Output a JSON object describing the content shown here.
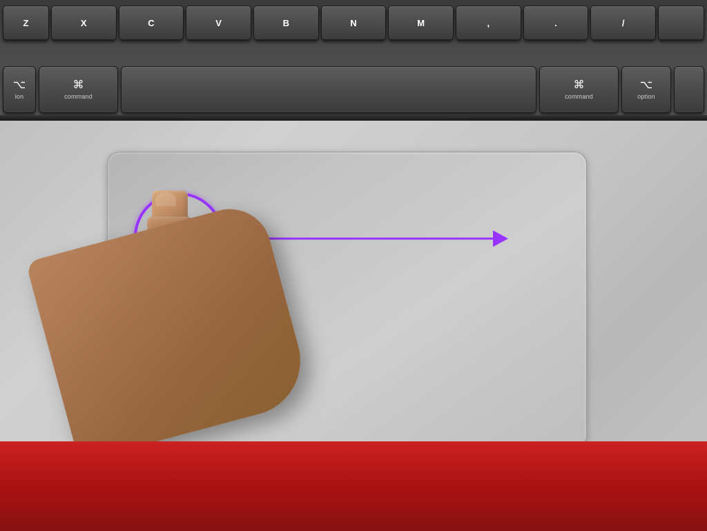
{
  "keyboard": {
    "top_row": {
      "keys": [
        "Z",
        "X",
        "C",
        "V",
        "B",
        "N",
        "M",
        ",",
        ".",
        "/"
      ]
    },
    "bottom_row": {
      "fn_symbol": "",
      "fn_label": "ion",
      "command_left_symbol": "⌘",
      "command_left_label": "command",
      "space_label": "",
      "command_right_symbol": "⌘",
      "command_right_label": "command",
      "option_right_symbol": "⌥",
      "option_right_label": "option"
    }
  },
  "annotation": {
    "circle_color": "#9933ff",
    "arrow_color": "#9933ff",
    "description": "finger swiping right on trackpad"
  },
  "accent_color": "#cc44ff"
}
